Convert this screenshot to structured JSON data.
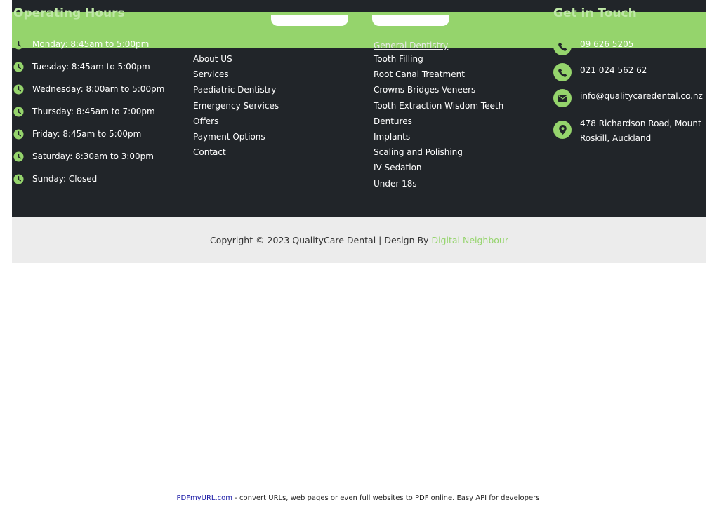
{
  "footer": {
    "hours_title": "Operating Hours",
    "contact_title": "Get in Touch",
    "hours": [
      "Monday: 8:45am to 5:00pm",
      "Tuesday: 8:45am to 5:00pm",
      "Wednesday: 8:00am to 5:00pm",
      "Thursday: 8:45am to 7:00pm",
      "Friday: 8:45am to 5:00pm",
      "Saturday: 8:30am to 3:00pm",
      "Sunday: Closed"
    ],
    "quick_links": [
      "About US",
      "Services",
      "Paediatric Dentistry",
      "Emergency Services",
      "Offers",
      "Payment Options",
      "Contact"
    ],
    "service_links_partial": "General Dentistry",
    "service_links": [
      "Tooth Filling",
      "Root Canal Treatment",
      "Crowns Bridges Veneers",
      "Tooth Extraction Wisdom Teeth",
      "Dentures",
      "Implants",
      "Scaling and Polishing",
      "IV Sedation",
      "Under 18s"
    ],
    "contact": {
      "phone1": "09 626 5205",
      "phone2": "021 024 562 62",
      "email": "info@qualitycaredental.co.nz",
      "address": "478 Richardson Road, Mount Roskill, Auckland"
    },
    "icons": {
      "clock": "clock-icon",
      "phone": "phone-icon",
      "email": "envelope-icon",
      "address": "map-pin-icon"
    },
    "colors": {
      "dark": "#212529",
      "accent": "#95d46c",
      "bottom_bar": "#ececec"
    }
  },
  "copyright": {
    "text": "Copyright © 2023 QualityCare Dental | Design By",
    "link": "Digital Neighbour"
  },
  "pdf_note": {
    "link": "PDFmyURL.com",
    "text": " - convert URLs, web pages or even full websites to PDF online. Easy API for developers!"
  }
}
